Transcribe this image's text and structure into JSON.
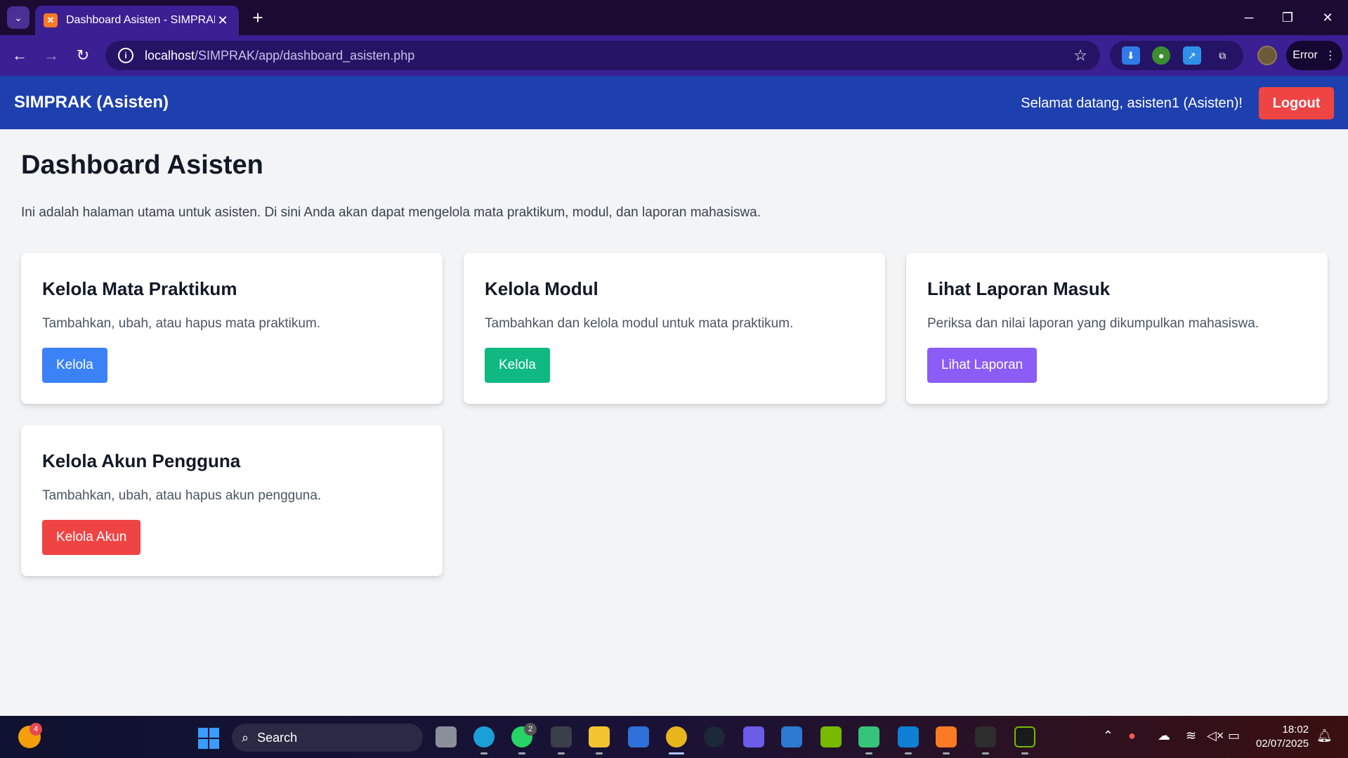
{
  "browser": {
    "tab_title": "Dashboard Asisten - SIMPRAK",
    "tab_favicon": "xampp-icon",
    "new_tab": "+",
    "url_host": "localhost",
    "url_path": "/SIMPRAK/app/dashboard_asisten.php",
    "profile_status": "Error"
  },
  "app": {
    "brand": "SIMPRAK (Asisten)",
    "welcome": "Selamat datang, asisten1 (Asisten)!",
    "logout_label": "Logout"
  },
  "page": {
    "title": "Dashboard Asisten",
    "description": "Ini adalah halaman utama untuk asisten. Di sini Anda akan dapat mengelola mata praktikum, modul, dan laporan mahasiswa."
  },
  "cards": [
    {
      "title": "Kelola Mata Praktikum",
      "description": "Tambahkan, ubah, atau hapus mata praktikum.",
      "button": "Kelola",
      "color": "#3b82f6"
    },
    {
      "title": "Kelola Modul",
      "description": "Tambahkan dan kelola modul untuk mata praktikum.",
      "button": "Kelola",
      "color": "#10b981"
    },
    {
      "title": "Lihat Laporan Masuk",
      "description": "Periksa dan nilai laporan yang dikumpulkan mahasiswa.",
      "button": "Lihat Laporan",
      "color": "#8b5cf6"
    },
    {
      "title": "Kelola Akun Pengguna",
      "description": "Tambahkan, ubah, atau hapus akun pengguna.",
      "button": "Kelola Akun",
      "color": "#ef4444"
    }
  ],
  "taskbar": {
    "search_label": "Search",
    "widget_badge": "4",
    "whatsapp_badge": "2",
    "time": "18:02",
    "date": "02/07/2025"
  },
  "colors": {
    "header": "#1e40af",
    "logout": "#ef4444",
    "page_bg": "#f3f4f6"
  }
}
